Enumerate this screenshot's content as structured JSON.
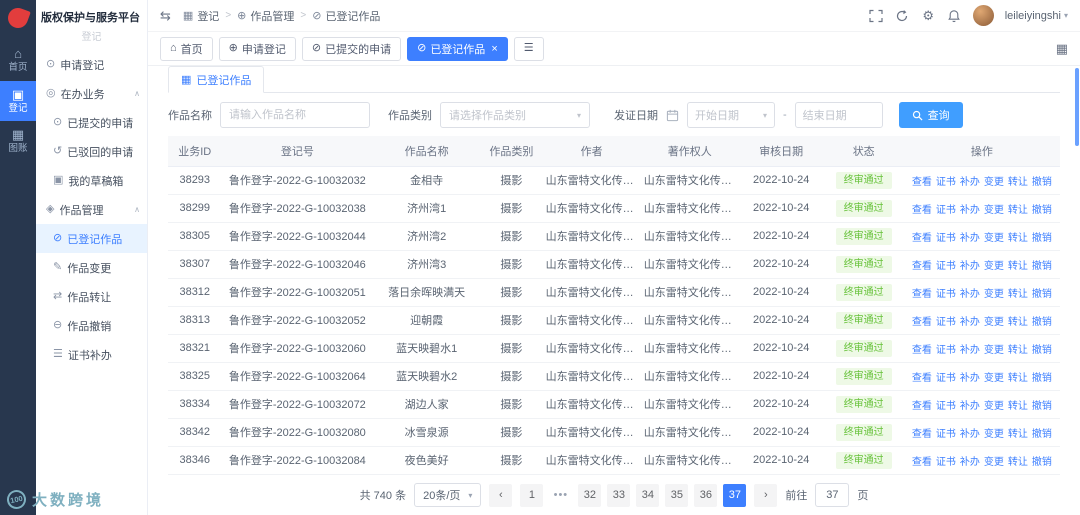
{
  "colors": {
    "accent": "#409eff",
    "active_blue": "#3d7fff",
    "success_text": "#67c23a",
    "success_bg": "#eef9e6",
    "rail_bg": "#28374e"
  },
  "brand": {
    "title": "版权保护与服务平台",
    "subtitle": "登记"
  },
  "watermark": {
    "badge": "100",
    "text": "大数跨境"
  },
  "icons": {
    "collapse": "⇆",
    "gear": "⚙",
    "caret_down": "▾",
    "grid": "▦",
    "panel_tab": "▦"
  },
  "rail": {
    "items": [
      {
        "key": "home",
        "label": "首页",
        "glyph": "⌂",
        "icon_name": "home-icon",
        "active": false
      },
      {
        "key": "register",
        "label": "登记",
        "glyph": "▣",
        "icon_name": "register-icon",
        "active": true
      },
      {
        "key": "gallery",
        "label": "图账",
        "glyph": "▦",
        "icon_name": "gallery-icon",
        "active": false
      }
    ]
  },
  "sidebar": {
    "items": [
      {
        "key": "apply-register",
        "label": "申请登记",
        "glyph": "⊙",
        "icon_name": "circle-dot-icon",
        "level": 1
      },
      {
        "key": "in-progress",
        "label": "在办业务",
        "glyph": "◎",
        "icon_name": "tasks-icon",
        "level": 1,
        "arrow": "∧"
      },
      {
        "key": "submitted-applications",
        "label": "已提交的申请",
        "glyph": "⊙",
        "icon_name": "submitted-icon",
        "level": 2
      },
      {
        "key": "rejected-applications",
        "label": "已驳回的申请",
        "glyph": "↺",
        "icon_name": "rejected-icon",
        "level": 2
      },
      {
        "key": "my-drafts",
        "label": "我的草稿箱",
        "glyph": "▣",
        "icon_name": "draft-icon",
        "level": 2
      },
      {
        "key": "works-management",
        "label": "作品管理",
        "glyph": "◈",
        "icon_name": "works-icon",
        "level": 1,
        "arrow": "∧"
      },
      {
        "key": "registered-works",
        "label": "已登记作品",
        "glyph": "⊘",
        "icon_name": "registered-works-icon",
        "level": 2,
        "active": true
      },
      {
        "key": "works-change",
        "label": "作品变更",
        "glyph": "✎",
        "icon_name": "edit-icon",
        "level": 2
      },
      {
        "key": "works-transfer",
        "label": "作品转让",
        "glyph": "⇄",
        "icon_name": "transfer-icon",
        "level": 2
      },
      {
        "key": "works-revoke",
        "label": "作品撤销",
        "glyph": "⊖",
        "icon_name": "revoke-icon",
        "level": 2
      },
      {
        "key": "certificate-reissue",
        "label": "证书补办",
        "glyph": "☰",
        "icon_name": "certificate-icon",
        "level": 2
      }
    ]
  },
  "header": {
    "breadcrumb": [
      {
        "label": "登记",
        "glyph": "▦",
        "icon_name": "grid-icon"
      },
      {
        "label": "作品管理",
        "glyph": "⊕",
        "icon_name": "plus-circle-icon"
      },
      {
        "label": "已登记作品",
        "glyph": "⊘",
        "icon_name": "doc-check-icon"
      }
    ],
    "user": "leileiyingshi"
  },
  "tabs": [
    {
      "key": "home",
      "label": "首页",
      "glyph": "⌂",
      "icon_name": "home-icon"
    },
    {
      "key": "apply-register",
      "label": "申请登记",
      "glyph": "⊕",
      "icon_name": "plus-circle-icon"
    },
    {
      "key": "submitted-applications",
      "label": "已提交的申请",
      "glyph": "⊘",
      "icon_name": "doc-check-icon"
    },
    {
      "key": "registered-works",
      "label": "已登记作品",
      "glyph": "⊘",
      "icon_name": "doc-check-icon",
      "active": true,
      "closable": true
    },
    {
      "key": "more",
      "label": "",
      "glyph": "☰",
      "icon_name": "menu-icon"
    }
  ],
  "panel": {
    "tab": "已登记作品"
  },
  "filters": {
    "name_label": "作品名称",
    "name_placeholder": "请输入作品名称",
    "category_label": "作品类别",
    "category_placeholder": "请选择作品类别",
    "date_label": "发证日期",
    "date_start": "开始日期",
    "date_sep": "-",
    "date_end": "结束日期",
    "search_label": "查询"
  },
  "table": {
    "columns": [
      "业务ID",
      "登记号",
      "作品名称",
      "作品类别",
      "作者",
      "著作权人",
      "审核日期",
      "状态",
      "操作"
    ],
    "operations": [
      {
        "key": "view",
        "label": "查看"
      },
      {
        "key": "certificate",
        "label": "证书"
      },
      {
        "key": "reissue",
        "label": "补办"
      },
      {
        "key": "change",
        "label": "变更"
      },
      {
        "key": "transfer",
        "label": "转让"
      },
      {
        "key": "revoke",
        "label": "撤销"
      }
    ],
    "rows": [
      {
        "id": "38293",
        "reg": "鲁作登字-2022-G-10032032",
        "name": "金相寺",
        "category": "摄影",
        "author": "山东雷特文化传媒…",
        "owner": "山东雷特文化传媒…",
        "date": "2022-10-24",
        "status": "终审通过"
      },
      {
        "id": "38299",
        "reg": "鲁作登字-2022-G-10032038",
        "name": "济州湾1",
        "category": "摄影",
        "author": "山东雷特文化传媒…",
        "owner": "山东雷特文化传媒…",
        "date": "2022-10-24",
        "status": "终审通过"
      },
      {
        "id": "38305",
        "reg": "鲁作登字-2022-G-10032044",
        "name": "济州湾2",
        "category": "摄影",
        "author": "山东雷特文化传媒…",
        "owner": "山东雷特文化传媒…",
        "date": "2022-10-24",
        "status": "终审通过"
      },
      {
        "id": "38307",
        "reg": "鲁作登字-2022-G-10032046",
        "name": "济州湾3",
        "category": "摄影",
        "author": "山东雷特文化传媒…",
        "owner": "山东雷特文化传媒…",
        "date": "2022-10-24",
        "status": "终审通过"
      },
      {
        "id": "38312",
        "reg": "鲁作登字-2022-G-10032051",
        "name": "落日余晖映满天",
        "category": "摄影",
        "author": "山东雷特文化传媒…",
        "owner": "山东雷特文化传媒…",
        "date": "2022-10-24",
        "status": "终审通过"
      },
      {
        "id": "38313",
        "reg": "鲁作登字-2022-G-10032052",
        "name": "迎朝霞",
        "category": "摄影",
        "author": "山东雷特文化传媒…",
        "owner": "山东雷特文化传媒…",
        "date": "2022-10-24",
        "status": "终审通过"
      },
      {
        "id": "38321",
        "reg": "鲁作登字-2022-G-10032060",
        "name": "蓝天映碧水1",
        "category": "摄影",
        "author": "山东雷特文化传媒…",
        "owner": "山东雷特文化传媒…",
        "date": "2022-10-24",
        "status": "终审通过"
      },
      {
        "id": "38325",
        "reg": "鲁作登字-2022-G-10032064",
        "name": "蓝天映碧水2",
        "category": "摄影",
        "author": "山东雷特文化传媒…",
        "owner": "山东雷特文化传媒…",
        "date": "2022-10-24",
        "status": "终审通过"
      },
      {
        "id": "38334",
        "reg": "鲁作登字-2022-G-10032072",
        "name": "湖边人家",
        "category": "摄影",
        "author": "山东雷特文化传媒…",
        "owner": "山东雷特文化传媒…",
        "date": "2022-10-24",
        "status": "终审通过"
      },
      {
        "id": "38342",
        "reg": "鲁作登字-2022-G-10032080",
        "name": "冰雪泉源",
        "category": "摄影",
        "author": "山东雷特文化传媒…",
        "owner": "山东雷特文化传媒…",
        "date": "2022-10-24",
        "status": "终审通过"
      },
      {
        "id": "38346",
        "reg": "鲁作登字-2022-G-10032084",
        "name": "夜色美好",
        "category": "摄影",
        "author": "山东雷特文化传媒…",
        "owner": "山东雷特文化传媒…",
        "date": "2022-10-24",
        "status": "终审通过"
      }
    ]
  },
  "pagination": {
    "total": "共 740 条",
    "page_size": "20条/页",
    "prev": "‹",
    "next": "›",
    "pages": [
      "1",
      "•••",
      "32",
      "33",
      "34",
      "35",
      "36",
      "37"
    ],
    "active_page": "37",
    "goto_label": "前往",
    "goto_value": "37",
    "goto_suffix": "页"
  }
}
